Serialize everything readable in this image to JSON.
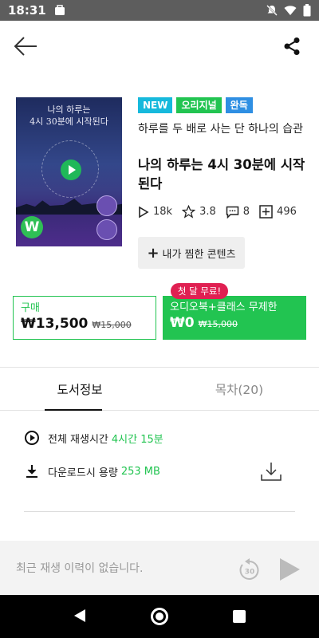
{
  "status_bar": {
    "time": "18:31"
  },
  "book": {
    "cover": {
      "title_line1": "나의 하루는",
      "title_line2": "4시 30분에 시작된다",
      "badge_letter": "W"
    },
    "badges": [
      "NEW",
      "오리지널",
      "완독"
    ],
    "subtitle": "하루를 두 배로 사는 단 하나의 습관",
    "title": "나의 하루는 4시 30분에 시작된다",
    "stats": {
      "plays": "18k",
      "rating": "3.8",
      "comments": "8",
      "adds": "496"
    },
    "pick_label": "내가 찜한 콘텐츠"
  },
  "purchase": {
    "buy_label": "구매",
    "buy_price": "₩13,500",
    "buy_original": "₩15,000",
    "free_tag": "첫 달 무료!",
    "sub_label": "오디오북+클래스 무제한",
    "sub_price": "₩0",
    "sub_original": "₩15,000"
  },
  "tabs": [
    {
      "label": "도서정보",
      "active": true
    },
    {
      "label": "목차(20)",
      "active": false
    }
  ],
  "info": {
    "playtime_label": "전체 재생시간",
    "playtime_value": "4시간 15분",
    "download_label": "다운로드시 용량",
    "download_value": "253 MB"
  },
  "player": {
    "empty_text": "최근 재생 이력이 없습니다.",
    "replay_seconds": "30"
  },
  "colors": {
    "accent": "#22c451",
    "new_badge": "#16b9dc",
    "done_badge": "#2f8fe3",
    "promo": "#e02052"
  }
}
